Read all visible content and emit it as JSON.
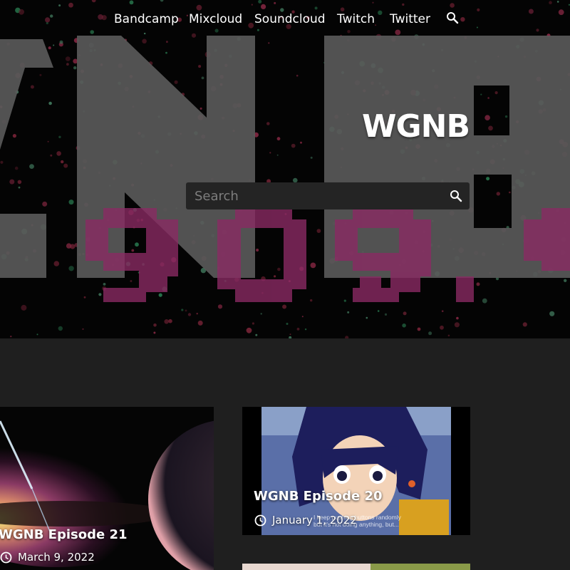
{
  "nav": {
    "items": [
      {
        "label": "Bandcamp"
      },
      {
        "label": "Mixcloud"
      },
      {
        "label": "Soundcloud"
      },
      {
        "label": "Twitch"
      },
      {
        "label": "Twitter"
      }
    ],
    "search_icon": "search-icon"
  },
  "header": {
    "site_title": "WGNB",
    "search": {
      "placeholder": "Search",
      "value": ""
    },
    "background_art": {
      "letters": "GNB",
      "frequency": "90.9"
    }
  },
  "posts": [
    {
      "title": "WGNB Episode 21",
      "date": "March 9, 2022",
      "date_icon": "clock-icon"
    },
    {
      "title": "WGNB Episode 20",
      "date": "January 1, 2022",
      "date_icon": "clock-icon",
      "thumbnail_caption": "I keep pushing buttons randomly\nbut it's not doing anything, but..."
    }
  ],
  "colors": {
    "page_bg": "#1f1f1f",
    "hero_bg": "#050505",
    "search_bg": "#242424",
    "accent_magenta": "#8a2a63",
    "text": "#ffffff"
  }
}
